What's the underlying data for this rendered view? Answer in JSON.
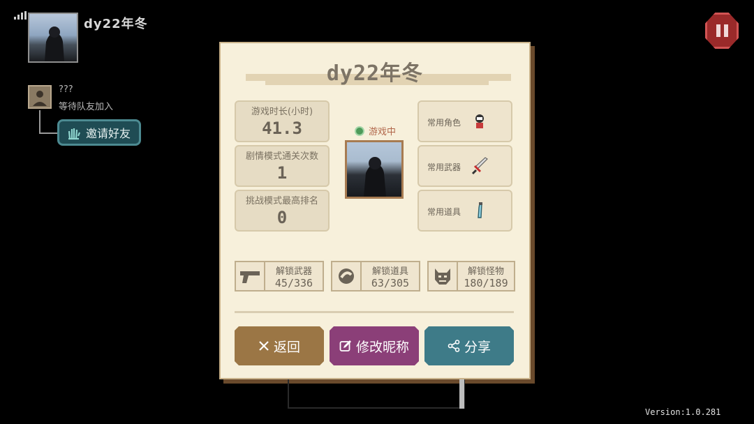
{
  "player": {
    "name": "dy22年冬"
  },
  "teammate": {
    "name": "???",
    "status": "等待队友加入"
  },
  "invite": {
    "label": "邀请好友"
  },
  "panel": {
    "title": "dy22年冬",
    "status": "游戏中",
    "stats": [
      {
        "label": "游戏时长(小时)",
        "value": "41.3"
      },
      {
        "label": "剧情模式通关次数",
        "value": "1"
      },
      {
        "label": "挑战模式最高排名",
        "value": "0"
      }
    ],
    "favorites": [
      {
        "label": "常用角色",
        "icon": "character-icon"
      },
      {
        "label": "常用武器",
        "icon": "sword-icon"
      },
      {
        "label": "常用道具",
        "icon": "potion-icon"
      }
    ],
    "unlocks": [
      {
        "label": "解锁武器",
        "value": "45/336",
        "icon": "pistol-icon"
      },
      {
        "label": "解锁道具",
        "value": "63/305",
        "icon": "item-icon"
      },
      {
        "label": "解锁怪物",
        "value": "180/189",
        "icon": "monster-icon"
      }
    ],
    "buttons": {
      "back": "返回",
      "rename": "修改昵称",
      "share": "分享"
    }
  },
  "version": "Version:1.0.281",
  "colors": {
    "panel_bg": "#f7f0db",
    "back": "#9b7645",
    "rename": "#8b3f78",
    "share": "#3e7b88",
    "pause": "#9a2a2a"
  }
}
